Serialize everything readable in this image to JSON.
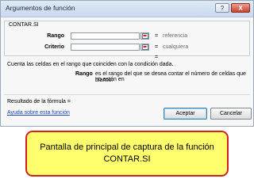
{
  "window": {
    "title": "Argumentos de función",
    "help_label": "?",
    "close_label": "X"
  },
  "function_group": {
    "name": "CONTAR.SI",
    "arguments": [
      {
        "label": "Rango",
        "value": "",
        "equals": "=",
        "hint": "referencia"
      },
      {
        "label": "Criterio",
        "value": "",
        "equals": "=",
        "hint": "cualquiera"
      }
    ],
    "result_equals": "="
  },
  "description": {
    "summary": "Cuenta las celdas en el rango que coinciden con la condición dada.",
    "arg_name": "Rango",
    "arg_text_line1": "es el rango del que se desea contar el número de celdas que no están en",
    "arg_text_line2": "blanco."
  },
  "footer": {
    "formula_result_label": "Resultado de la fórmula =",
    "help_link": "Ayuda sobre esta función",
    "ok_label": "Aceptar",
    "cancel_label": "Cancelar"
  },
  "caption": {
    "text": "Pantalla de principal de captura de la función CONTAR.SI",
    "background": "#ffff6e",
    "border": "#d62020"
  },
  "icons": {
    "collapse": "collapse-dialog-icon"
  }
}
